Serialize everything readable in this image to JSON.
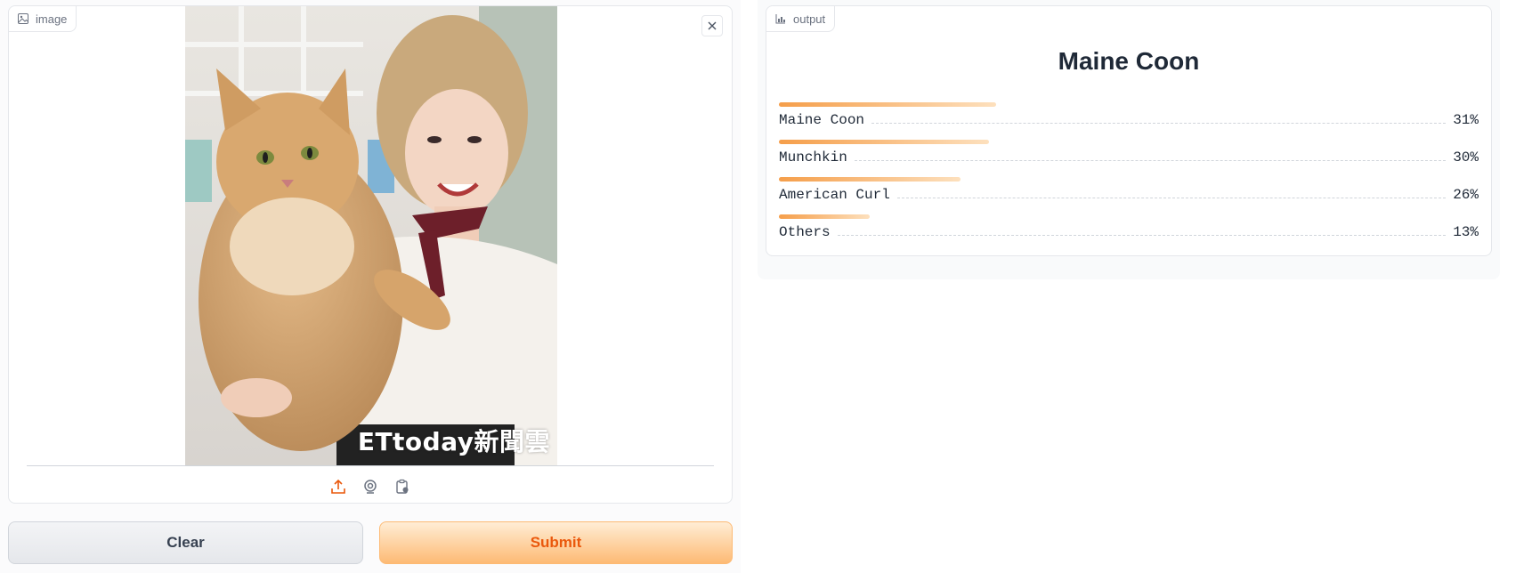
{
  "input": {
    "label": "image",
    "image_alt": "Photo of an orange long-haired cat held by a smiling woman",
    "watermark": "ETtoday新聞雲"
  },
  "buttons": {
    "clear": "Clear",
    "submit": "Submit"
  },
  "output": {
    "label": "output",
    "prediction": "Maine Coon",
    "confidences": [
      {
        "label": "Maine Coon",
        "percent_text": "31%",
        "value": 31
      },
      {
        "label": "Munchkin",
        "percent_text": "30%",
        "value": 30
      },
      {
        "label": "American Curl",
        "percent_text": "26%",
        "value": 26
      },
      {
        "label": "Others",
        "percent_text": "13%",
        "value": 13
      }
    ]
  },
  "icons": {
    "image_label_icon": "image-icon",
    "output_label_icon": "chart-icon",
    "close": "close-icon",
    "upload": "upload-icon",
    "webcam": "webcam-icon",
    "clipboard": "clipboard-icon"
  },
  "colors": {
    "accent": "#ea580c",
    "bar_start": "#f59e4a",
    "bar_end": "#fde0bd"
  }
}
